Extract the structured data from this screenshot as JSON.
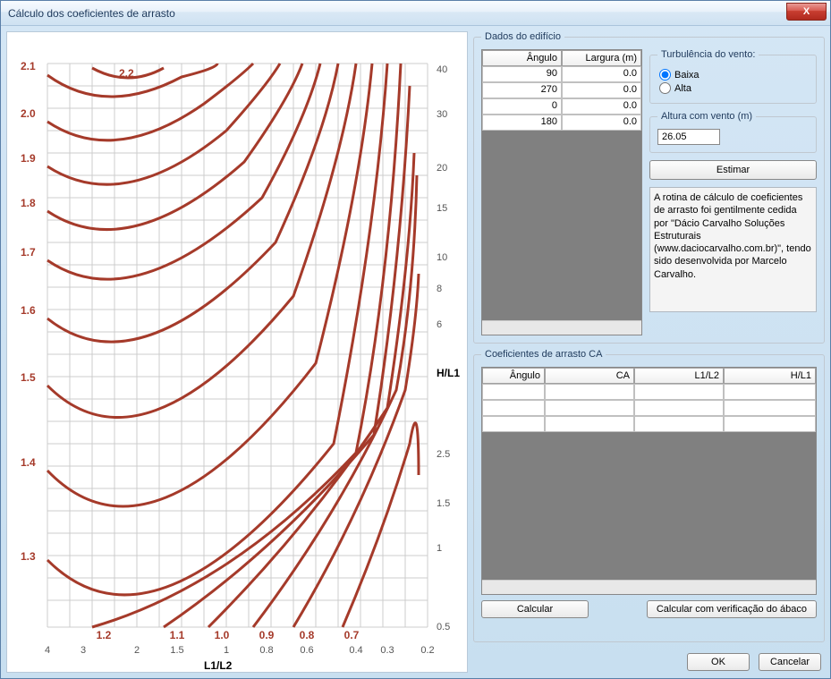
{
  "window": {
    "title": "Cálculo dos coeficientes de arrasto",
    "close_label": "X"
  },
  "chart": {
    "xlabel": "L1/L2",
    "ylabel": "H/L1",
    "y_left_ticks": [
      "2.1",
      "2.0",
      "1.9",
      "1.8",
      "1.7",
      "1.6",
      "1.5",
      "1.4",
      "1.3"
    ],
    "y_right_ticks": [
      "40",
      "30",
      "20",
      "15",
      "10",
      "8",
      "6",
      "2.5",
      "1.5",
      "1",
      "0.5"
    ],
    "x_bottom_ticks": [
      "4",
      "3",
      "2",
      "1.5",
      "1",
      "0.8",
      "0.6",
      "0.4",
      "0.3",
      "0.2"
    ],
    "curve_labels": [
      "1.2",
      "1.1",
      "1.0",
      "0.9",
      "0.8",
      "0.7"
    ],
    "curve_label_22": "2.2"
  },
  "dados": {
    "legend": "Dados do edifício",
    "table_headers": [
      "Ângulo",
      "Largura (m)"
    ],
    "table_rows": [
      {
        "angulo": "90",
        "largura": "0.0"
      },
      {
        "angulo": "270",
        "largura": "0.0"
      },
      {
        "angulo": "0",
        "largura": "0.0"
      },
      {
        "angulo": "180",
        "largura": "0.0"
      }
    ],
    "turbulencia": {
      "legend": "Turbulência do vento:",
      "baixa": "Baixa",
      "alta": "Alta"
    },
    "altura": {
      "legend": "Altura com vento (m)",
      "value": "26.05"
    },
    "estimar_label": "Estimar",
    "info_text": "A rotina de cálculo de coeficientes de arrasto foi gentilmente cedida por \"Dácio Carvalho Soluções Estruturais (www.daciocarvalho.com.br)\", tendo sido desenvolvida por Marcelo Carvalho."
  },
  "ca": {
    "legend": "Coeficientes de arrasto CA",
    "headers": [
      "Ângulo",
      "CA",
      "L1/L2",
      "H/L1"
    ],
    "calcular_label": "Calcular",
    "calcular_verif_label": "Calcular com verificação do ábaco"
  },
  "buttons": {
    "ok": "OK",
    "cancel": "Cancelar"
  },
  "chart_data": {
    "type": "line",
    "title": "Cálculo dos coeficientes de arrasto",
    "xlabel": "L1/L2",
    "ylabel": "H/L1",
    "x_ticks": [
      4,
      3,
      2,
      1.5,
      1,
      0.8,
      0.6,
      0.4,
      0.3,
      0.2
    ],
    "y_left_range": [
      1.2,
      2.2
    ],
    "y_right_ticks": [
      0.5,
      1,
      1.5,
      2.5,
      6,
      8,
      10,
      15,
      20,
      30,
      40
    ],
    "contour_values": [
      1.2,
      1.3,
      1.4,
      1.5,
      1.6,
      1.7,
      1.8,
      1.9,
      2.0,
      2.1,
      2.2,
      0.7,
      0.8,
      0.9,
      1.0,
      1.1
    ],
    "note": "Nomograph / abacus chart: curved iso-lines for drag coefficient CA as function of L1/L2 (bottom axis, log-like spacing 4→0.2) and H/L1 (right axis, log-like spacing 0.5→40). Left axis shows CA contour labels 1.3–2.1; bottom-right curve labels 0.7–1.2; one small concave curve near top labeled 2.2."
  }
}
